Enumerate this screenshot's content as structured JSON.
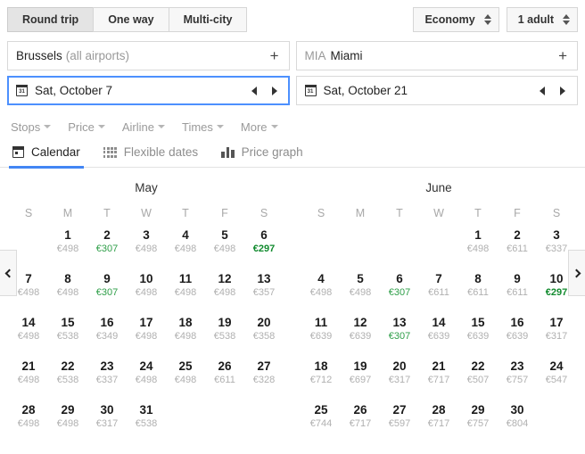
{
  "trip_types": [
    {
      "label": "Round trip",
      "selected": true
    },
    {
      "label": "One way",
      "selected": false
    },
    {
      "label": "Multi-city",
      "selected": false
    }
  ],
  "cabin": {
    "label": "Economy"
  },
  "passengers": {
    "label": "1 adult"
  },
  "origin": {
    "main": "Brussels",
    "sub": "(all airports)",
    "add": "+"
  },
  "destination": {
    "code": "MIA",
    "main": "Miami",
    "add": "+"
  },
  "depart_date": {
    "icon_label": "31",
    "value": "Sat, October 7"
  },
  "return_date": {
    "icon_label": "31",
    "value": "Sat, October 21"
  },
  "filters": [
    {
      "label": "Stops"
    },
    {
      "label": "Price"
    },
    {
      "label": "Airline"
    },
    {
      "label": "Times"
    },
    {
      "label": "More"
    }
  ],
  "tabs": [
    {
      "label": "Calendar",
      "icon": "calendar-icon",
      "active": true
    },
    {
      "label": "Flexible dates",
      "icon": "grid-icon",
      "active": false
    },
    {
      "label": "Price graph",
      "icon": "bar-chart-icon",
      "active": false
    }
  ],
  "nav": {
    "prev": "‹",
    "next": "›"
  },
  "dow": [
    "S",
    "M",
    "T",
    "W",
    "T",
    "F",
    "S"
  ],
  "months": [
    {
      "name": "May",
      "lead_blanks": 1,
      "days": [
        {
          "d": 1,
          "p": "€498"
        },
        {
          "d": 2,
          "p": "€307",
          "cheap": true
        },
        {
          "d": 3,
          "p": "€498"
        },
        {
          "d": 4,
          "p": "€498"
        },
        {
          "d": 5,
          "p": "€498"
        },
        {
          "d": 6,
          "p": "€297",
          "cheapest": true
        },
        {
          "d": 7,
          "p": "€498"
        },
        {
          "d": 8,
          "p": "€498"
        },
        {
          "d": 9,
          "p": "€307",
          "cheap": true
        },
        {
          "d": 10,
          "p": "€498"
        },
        {
          "d": 11,
          "p": "€498"
        },
        {
          "d": 12,
          "p": "€498"
        },
        {
          "d": 13,
          "p": "€357"
        },
        {
          "d": 14,
          "p": "€498"
        },
        {
          "d": 15,
          "p": "€538"
        },
        {
          "d": 16,
          "p": "€349"
        },
        {
          "d": 17,
          "p": "€498"
        },
        {
          "d": 18,
          "p": "€498"
        },
        {
          "d": 19,
          "p": "€538"
        },
        {
          "d": 20,
          "p": "€358"
        },
        {
          "d": 21,
          "p": "€498"
        },
        {
          "d": 22,
          "p": "€538"
        },
        {
          "d": 23,
          "p": "€337"
        },
        {
          "d": 24,
          "p": "€498"
        },
        {
          "d": 25,
          "p": "€498"
        },
        {
          "d": 26,
          "p": "€611"
        },
        {
          "d": 27,
          "p": "€328"
        },
        {
          "d": 28,
          "p": "€498"
        },
        {
          "d": 29,
          "p": "€498"
        },
        {
          "d": 30,
          "p": "€317"
        },
        {
          "d": 31,
          "p": "€538"
        }
      ]
    },
    {
      "name": "June",
      "lead_blanks": 4,
      "days": [
        {
          "d": 1,
          "p": "€498"
        },
        {
          "d": 2,
          "p": "€611"
        },
        {
          "d": 3,
          "p": "€337"
        },
        {
          "d": 4,
          "p": "€498"
        },
        {
          "d": 5,
          "p": "€498"
        },
        {
          "d": 6,
          "p": "€307",
          "cheap": true
        },
        {
          "d": 7,
          "p": "€611"
        },
        {
          "d": 8,
          "p": "€611"
        },
        {
          "d": 9,
          "p": "€611"
        },
        {
          "d": 10,
          "p": "€297",
          "cheapest": true
        },
        {
          "d": 11,
          "p": "€639"
        },
        {
          "d": 12,
          "p": "€639"
        },
        {
          "d": 13,
          "p": "€307",
          "cheap": true
        },
        {
          "d": 14,
          "p": "€639"
        },
        {
          "d": 15,
          "p": "€639"
        },
        {
          "d": 16,
          "p": "€639"
        },
        {
          "d": 17,
          "p": "€317"
        },
        {
          "d": 18,
          "p": "€712"
        },
        {
          "d": 19,
          "p": "€697"
        },
        {
          "d": 20,
          "p": "€317"
        },
        {
          "d": 21,
          "p": "€717"
        },
        {
          "d": 22,
          "p": "€507"
        },
        {
          "d": 23,
          "p": "€757"
        },
        {
          "d": 24,
          "p": "€547"
        },
        {
          "d": 25,
          "p": "€744"
        },
        {
          "d": 26,
          "p": "€717"
        },
        {
          "d": 27,
          "p": "€597"
        },
        {
          "d": 28,
          "p": "€717"
        },
        {
          "d": 29,
          "p": "€757"
        },
        {
          "d": 30,
          "p": "€804"
        }
      ]
    }
  ],
  "colors": {
    "accent": "#4285f4",
    "cheap": "#2e9e48",
    "cheapest": "#128b2f",
    "focus": "#4d90fe"
  }
}
